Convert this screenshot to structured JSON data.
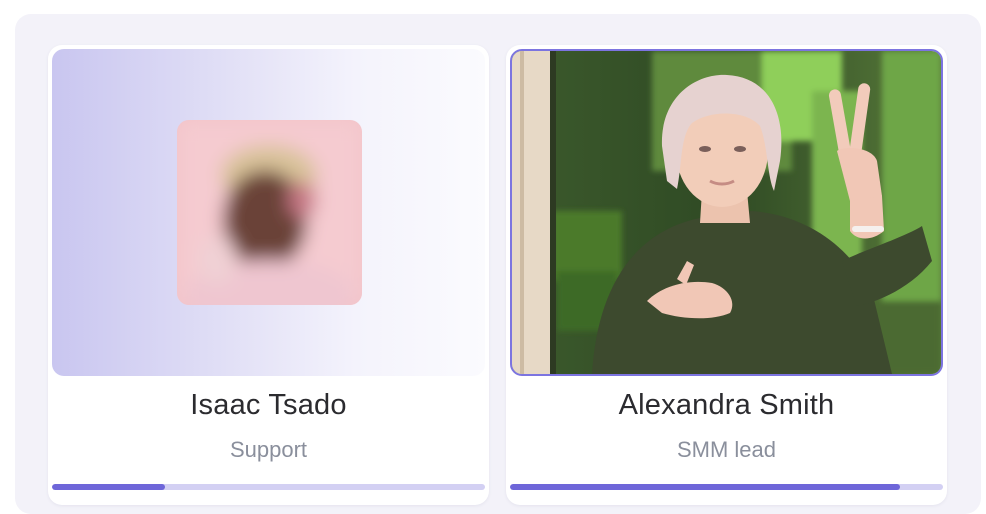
{
  "participants": [
    {
      "name": "Isaac Tsado",
      "role": "Support",
      "progress": 0.26,
      "video_on": false,
      "speaking": false
    },
    {
      "name": "Alexandra Smith",
      "role": "SMM lead",
      "progress": 0.9,
      "video_on": true,
      "speaking": true
    }
  ],
  "colors": {
    "accent": "#6e66d9",
    "track": "#d3d0f3",
    "speaking_border": "#7c74e0",
    "panel_bg": "#f3f2f9"
  }
}
